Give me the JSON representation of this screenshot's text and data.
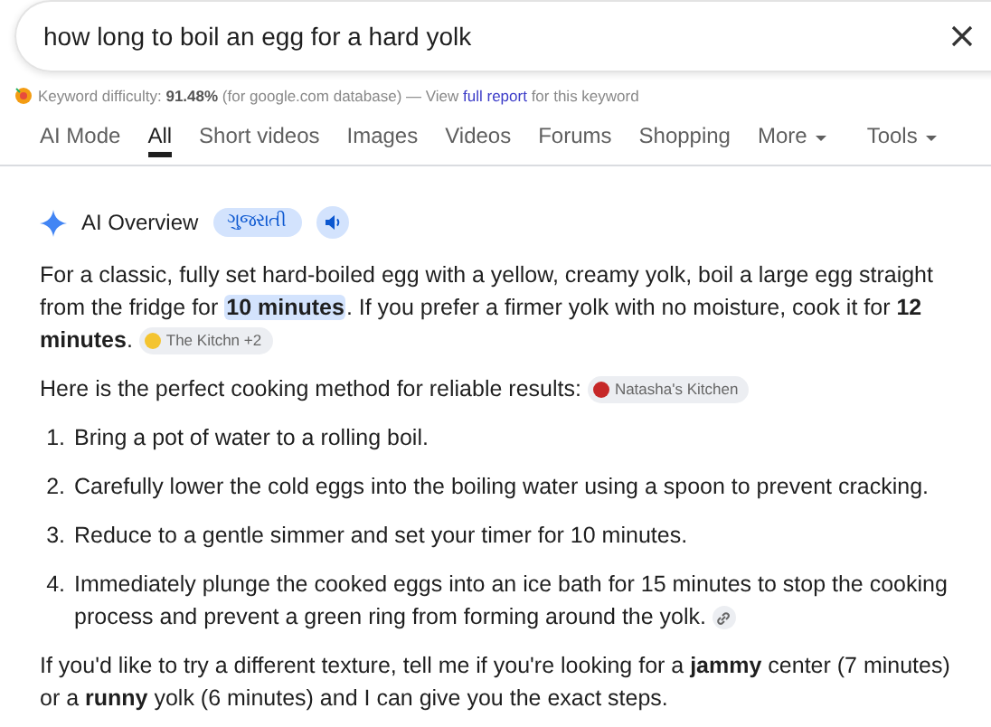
{
  "search": {
    "value": "how long to boil an egg for a hard yolk"
  },
  "keyword_bar": {
    "before": "Keyword difficulty: **91.48%** (for google.com database) — View ",
    "link": "full report",
    "after": " for this keyword"
  },
  "tabs": [
    {
      "label": "AI Mode",
      "selected": false,
      "menu": false
    },
    {
      "label": "All",
      "selected": true,
      "menu": false
    },
    {
      "label": "Short videos",
      "selected": false,
      "menu": false
    },
    {
      "label": "Images",
      "selected": false,
      "menu": false
    },
    {
      "label": "Videos",
      "selected": false,
      "menu": false
    },
    {
      "label": "Forums",
      "selected": false,
      "menu": false
    },
    {
      "label": "Shopping",
      "selected": false,
      "menu": false
    },
    {
      "label": "More",
      "selected": false,
      "menu": true
    },
    {
      "label": "Tools",
      "selected": false,
      "menu": true
    }
  ],
  "overview": {
    "title": "AI Overview",
    "language_chip": "ગુજરાતી",
    "intro": [
      {
        "text": "For a classic, fully set hard-boiled egg with a yellow, creamy yolk, boil a large egg straight from the fridge for ",
        "highlighted": false
      },
      {
        "text": "10 minutes",
        "highlighted": true
      },
      {
        "text": ". If you prefer a firmer yolk with no moisture, cook it for **12 minutes**. ",
        "highlighted": false
      }
    ],
    "intro_source": {
      "label": "The Kitchn +2",
      "color": "#f4c430"
    },
    "method": "Here is the perfect cooking method for reliable results: ",
    "method_source": {
      "label": "Natasha's Kitchen",
      "color": "#c62828"
    },
    "steps": [
      {
        "number": "1.",
        "text": "Bring a pot of water to a rolling boil.",
        "link": false
      },
      {
        "number": "2.",
        "text": "Carefully lower the cold eggs into the boiling water using a spoon to prevent cracking.",
        "link": false
      },
      {
        "number": "3.",
        "text": "Reduce to a gentle simmer and set your timer for 10 minutes.",
        "link": false
      },
      {
        "number": "4.",
        "text": "Immediately plunge the cooked eggs into an ice bath for 15 minutes to stop the cooking process and prevent a green ring from forming around the yolk. ",
        "link": true
      }
    ],
    "closing": "If you'd like to try a different texture, tell me if you're looking for a **jammy** center (7 minutes) or a **runny** yolk (6 minutes) and I can give you the exact steps."
  }
}
